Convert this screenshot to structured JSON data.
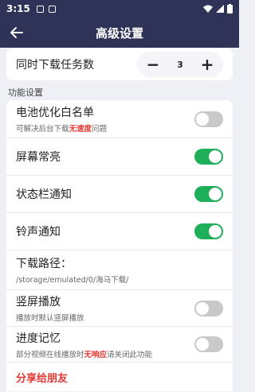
{
  "status": {
    "time": "3:15"
  },
  "header": {
    "title": "高级设置"
  },
  "counter": {
    "label": "同时下载任务数",
    "value": "3",
    "minus": "−",
    "plus": "+"
  },
  "section": {
    "title": "功能设置"
  },
  "rows": [
    {
      "main": "电池优化白名单",
      "sub_before": "可解决后台下载",
      "sub_hl": "无速度",
      "sub_after": "问题",
      "toggle": "off"
    },
    {
      "main": "屏幕常亮",
      "toggle": "on"
    },
    {
      "main": "状态栏通知",
      "toggle": "on"
    },
    {
      "main": "铃声通知",
      "toggle": "on"
    },
    {
      "main": "下载路径：",
      "sub": "/storage/emulated/0/海马下载/"
    },
    {
      "main": "竖屏播放",
      "sub": "播放时默认竖屏播放",
      "toggle": "off"
    },
    {
      "main": "进度记忆",
      "sub_before": "部分视频在线播放时",
      "sub_hl": "无响应",
      "sub_after": "请关闭此功能",
      "toggle": "off"
    }
  ],
  "share": {
    "label": "分享给朋友"
  }
}
